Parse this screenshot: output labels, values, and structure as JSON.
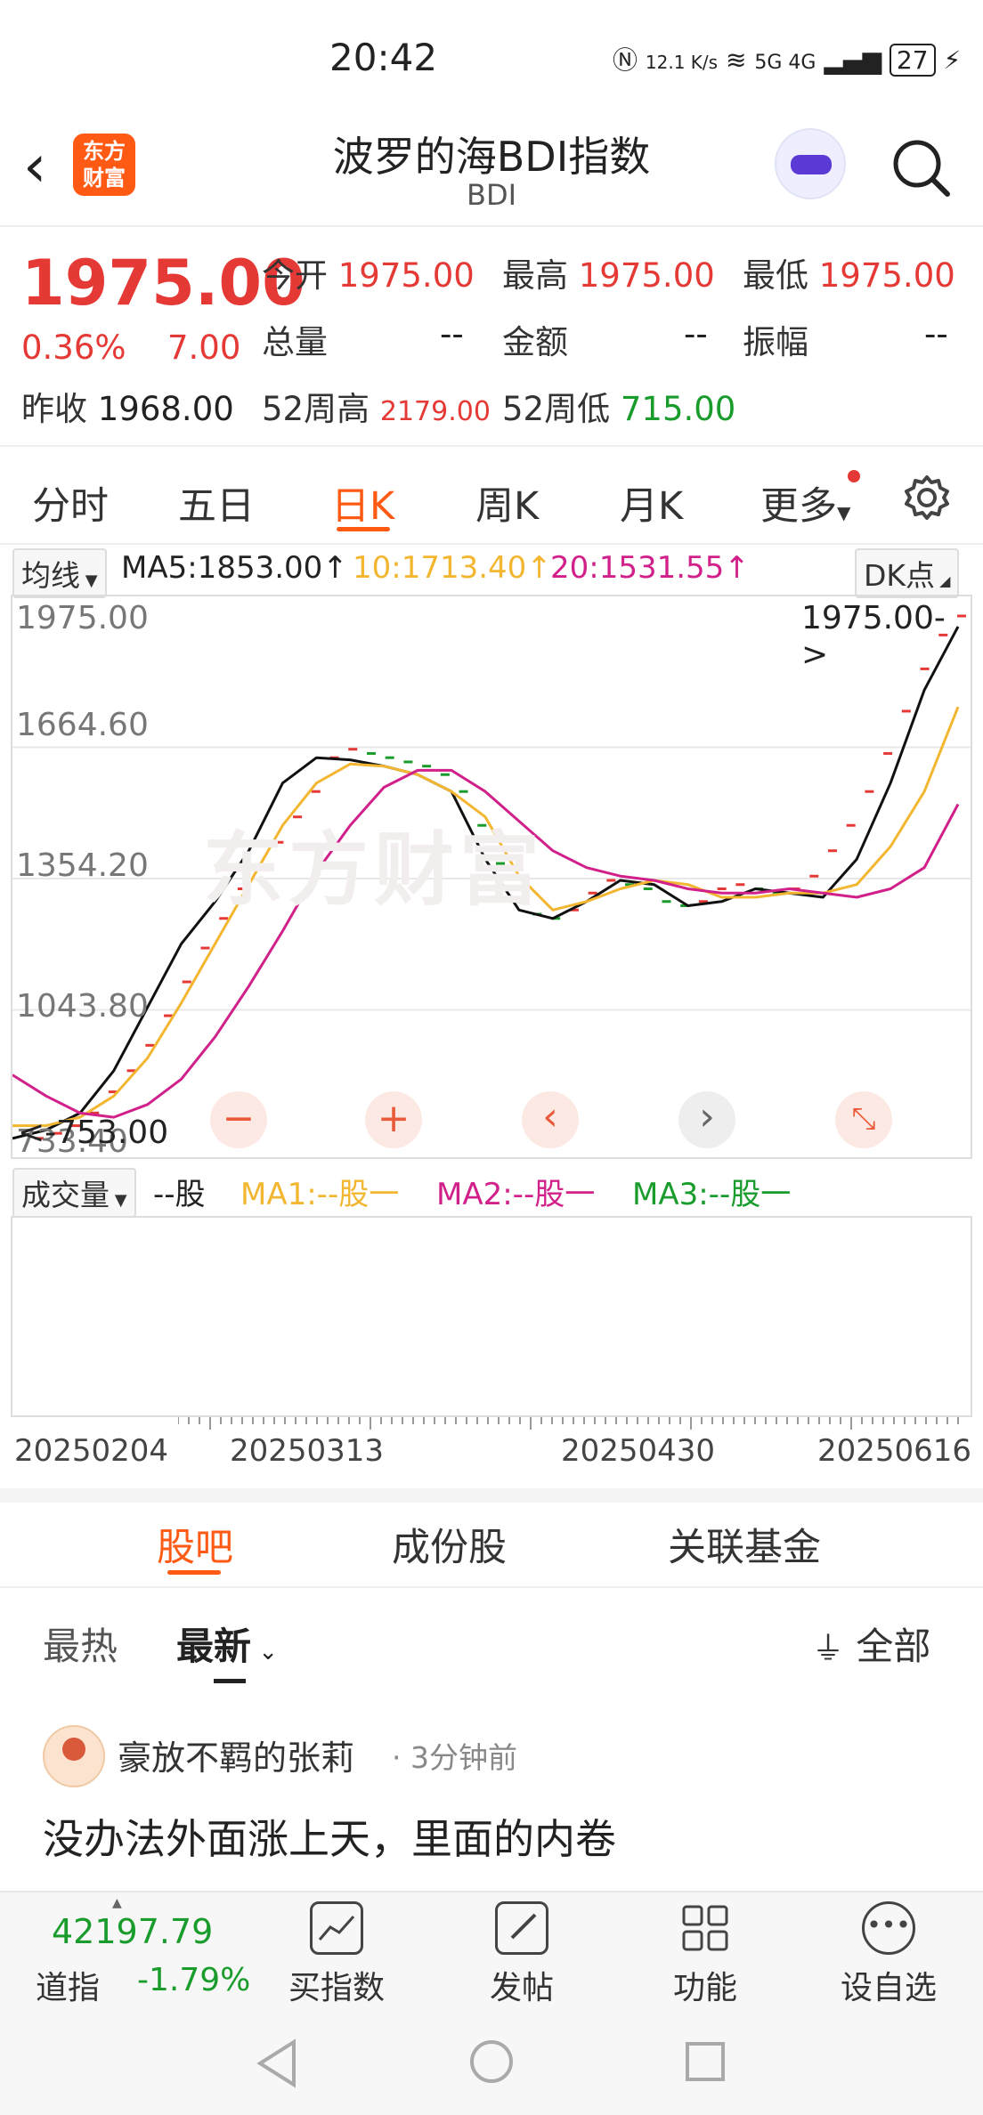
{
  "status_bar": {
    "time": "20:42",
    "net_speed": "12.1 K/s",
    "signals": "5G 4G",
    "battery": "27"
  },
  "header": {
    "title": "波罗的海BDI指数",
    "subtitle": "BDI",
    "logo_text_1": "东方",
    "logo_text_2": "财富"
  },
  "quote": {
    "price": "1975.00",
    "change_pct": "0.36%",
    "change": "7.00",
    "prev_close_label": "昨收",
    "prev_close": "1968.00",
    "open_label": "今开",
    "open": "1975.00",
    "high_label": "最高",
    "high": "1975.00",
    "low_label": "最低",
    "low": "1975.00",
    "volume_label": "总量",
    "volume": "--",
    "amount_label": "金额",
    "amount": "--",
    "amplitude_label": "振幅",
    "amplitude": "--",
    "high52_label": "52周高",
    "high52": "2179.00",
    "low52_label": "52周低",
    "low52": "715.00"
  },
  "kline_tabs": [
    {
      "label": "分时",
      "active": false
    },
    {
      "label": "五日",
      "active": false
    },
    {
      "label": "日K",
      "active": true
    },
    {
      "label": "周K",
      "active": false
    },
    {
      "label": "月K",
      "active": false
    },
    {
      "label": "更多",
      "active": false
    }
  ],
  "ma_line": {
    "selector": "均线",
    "ma5": "MA5:1853.00↑",
    "ma10": "10:1713.40↑",
    "ma20": "20:1531.55↑",
    "dk": "DK点"
  },
  "chart_data": {
    "type": "line",
    "y_ticks": [
      "1975.00",
      "1664.60",
      "1354.20",
      "1043.80",
      "733.40"
    ],
    "ylim": [
      733.4,
      1975.0
    ],
    "x_ticks": [
      "20250204",
      "20250313",
      "20250430",
      "20250616"
    ],
    "annotation_high": "1975.00->",
    "annotation_low": "<-753.00",
    "colors": {
      "ma5": "#111111",
      "ma10": "#f2b630",
      "ma20": "#d1208a",
      "up": "#e53935",
      "down": "#1a9c2c"
    },
    "series": [
      {
        "name": "MA5",
        "values": [
          740,
          760,
          800,
          900,
          1050,
          1200,
          1300,
          1420,
          1580,
          1640,
          1635,
          1620,
          1600,
          1560,
          1400,
          1280,
          1260,
          1300,
          1350,
          1340,
          1290,
          1300,
          1330,
          1320,
          1310,
          1400,
          1580,
          1800,
          1950
        ]
      },
      {
        "name": "10",
        "values": [
          770,
          770,
          790,
          840,
          930,
          1060,
          1200,
          1340,
          1480,
          1580,
          1625,
          1620,
          1600,
          1560,
          1500,
          1360,
          1280,
          1300,
          1330,
          1350,
          1340,
          1310,
          1310,
          1320,
          1320,
          1340,
          1430,
          1560,
          1760
        ]
      },
      {
        "name": "20",
        "values": [
          890,
          840,
          800,
          790,
          820,
          880,
          980,
          1100,
          1230,
          1370,
          1480,
          1570,
          1610,
          1610,
          1560,
          1490,
          1420,
          1380,
          1360,
          1350,
          1330,
          1320,
          1320,
          1330,
          1320,
          1310,
          1330,
          1380,
          1530
        ]
      }
    ],
    "daily_points": [
      740,
      752,
      770,
      800,
      850,
      900,
      960,
      1030,
      1110,
      1190,
      1260,
      1330,
      1380,
      1440,
      1500,
      1560,
      1640,
      1660,
      1650,
      1640,
      1630,
      1620,
      1600,
      1560,
      1480,
      1390,
      1300,
      1270,
      1260,
      1280,
      1320,
      1350,
      1340,
      1330,
      1300,
      1290,
      1300,
      1330,
      1340,
      1330,
      1320,
      1330,
      1360,
      1420,
      1480,
      1560,
      1650,
      1750,
      1850,
      1930,
      1975
    ]
  },
  "chart_controls": {
    "minus": "−",
    "plus": "+",
    "left": "‹",
    "right": "›"
  },
  "volume": {
    "selector": "成交量",
    "vol": "--股",
    "ma1": "MA1:--股一",
    "ma2": "MA2:--股一",
    "ma3": "MA3:--股一"
  },
  "sub_tabs": [
    {
      "label": "股吧",
      "active": true
    },
    {
      "label": "成份股",
      "active": false
    },
    {
      "label": "关联基金",
      "active": false
    }
  ],
  "filters": {
    "hot": "最热",
    "new": "最新",
    "all": "全部"
  },
  "post": {
    "user": "豪放不羁的张莉",
    "time": "· 3分钟前",
    "text": "没办法外面涨上天，里面的内卷"
  },
  "bottom_bar": {
    "index_value": "42197.79",
    "index_label": "道指",
    "index_change": "-1.79%",
    "buttons": [
      "买指数",
      "发帖",
      "功能",
      "设自选"
    ]
  }
}
